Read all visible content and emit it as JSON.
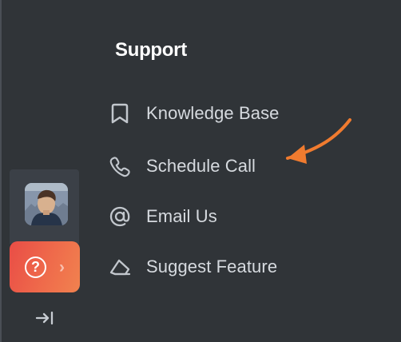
{
  "support": {
    "title": "Support",
    "items": [
      {
        "label": "Knowledge Base",
        "icon": "bookmark-icon"
      },
      {
        "label": "Schedule Call",
        "icon": "phone-icon"
      },
      {
        "label": "Email Us",
        "icon": "at-sign-icon"
      },
      {
        "label": "Suggest Feature",
        "icon": "eraser-icon"
      }
    ]
  },
  "sidebar": {
    "help_icon": "?",
    "help_chevron": "›",
    "avatar_icon": "avatar-photo",
    "collapse_icon": "collapse-right-icon"
  },
  "colors": {
    "background": "#303438",
    "rail": "#3b4047",
    "accent_start": "#e94d46",
    "accent_end": "#f1824f",
    "menu_text": "#d6dadf",
    "arrow": "#f07b2f"
  }
}
